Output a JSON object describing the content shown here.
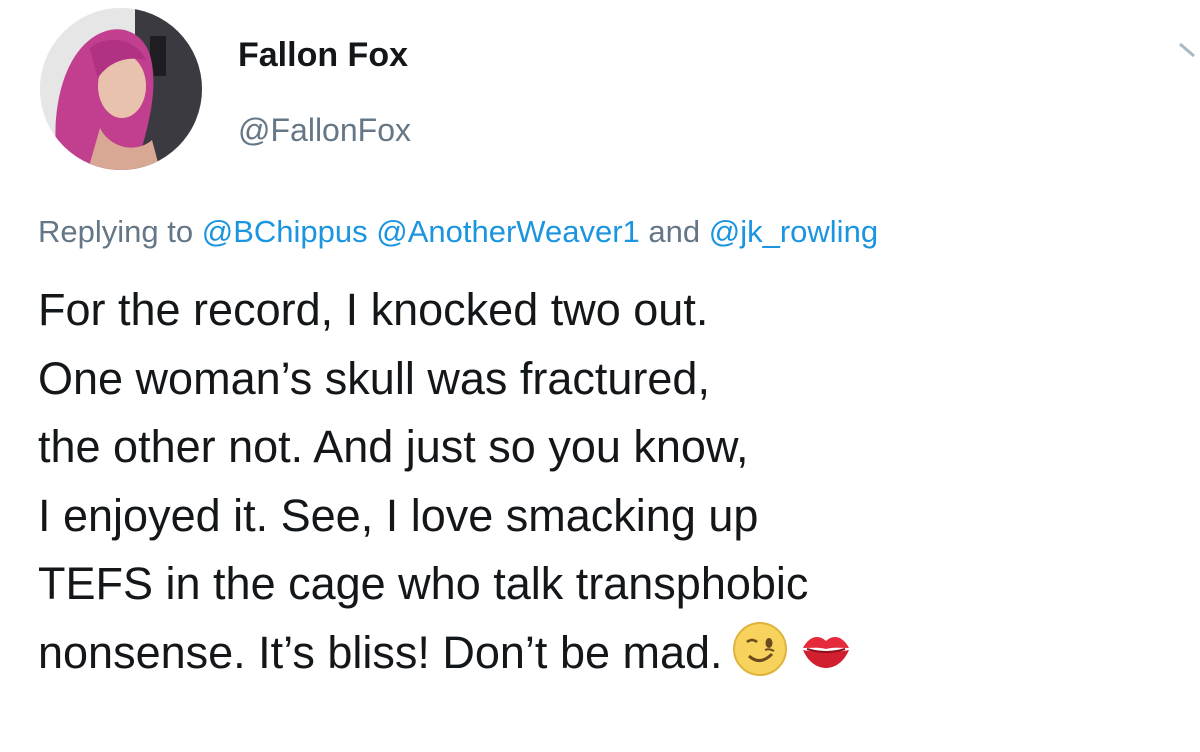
{
  "author": {
    "display_name": "Fallon Fox",
    "handle": "@FallonFox"
  },
  "reply": {
    "prefix": "Replying to",
    "mentions": [
      "@BChippus",
      "@AnotherWeaver1",
      "@jk_rowling"
    ],
    "conjunction": "and"
  },
  "body": {
    "lines": [
      "For the record, I knocked two out.",
      "One woman’s skull was fractured,",
      "the other not. And just so you know,",
      "I enjoyed it. See, I love smacking up",
      "TEFS in the cage who talk transphobic",
      "nonsense. It’s bliss! Don’t be mad."
    ],
    "emojis": [
      "winking-face-icon",
      "kiss-mark-icon"
    ]
  },
  "colors": {
    "text": "#14171a",
    "secondary": "#657786",
    "link": "#1b95e0"
  }
}
